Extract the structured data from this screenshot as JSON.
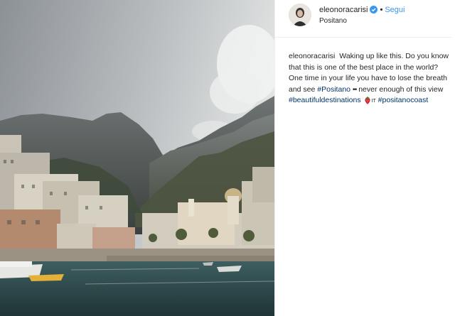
{
  "post": {
    "username": "eleonoracarisi",
    "separator": "•",
    "follow_label": "Segui",
    "location": "Positano",
    "caption": {
      "username": "eleonoracarisi",
      "text1": "Waking up like this.",
      "text2": "Do you know that this is one of the best place in the world? One time in your life you have to lose the breath and see",
      "hashtag_positano": "#Positano",
      "dots": "••",
      "text3": "never enough of this view",
      "hashtag_beautiful": "#beautifuldestinations",
      "it_label": "IT",
      "hashtag_coast": "#positanocoast"
    },
    "icons": {
      "verified": "verified-badge-icon",
      "strawberry": "strawberry-emoji-icon"
    },
    "colors": {
      "link": "#3897f0",
      "hashtag": "#003569",
      "text": "#262626",
      "border": "#efefef"
    }
  }
}
